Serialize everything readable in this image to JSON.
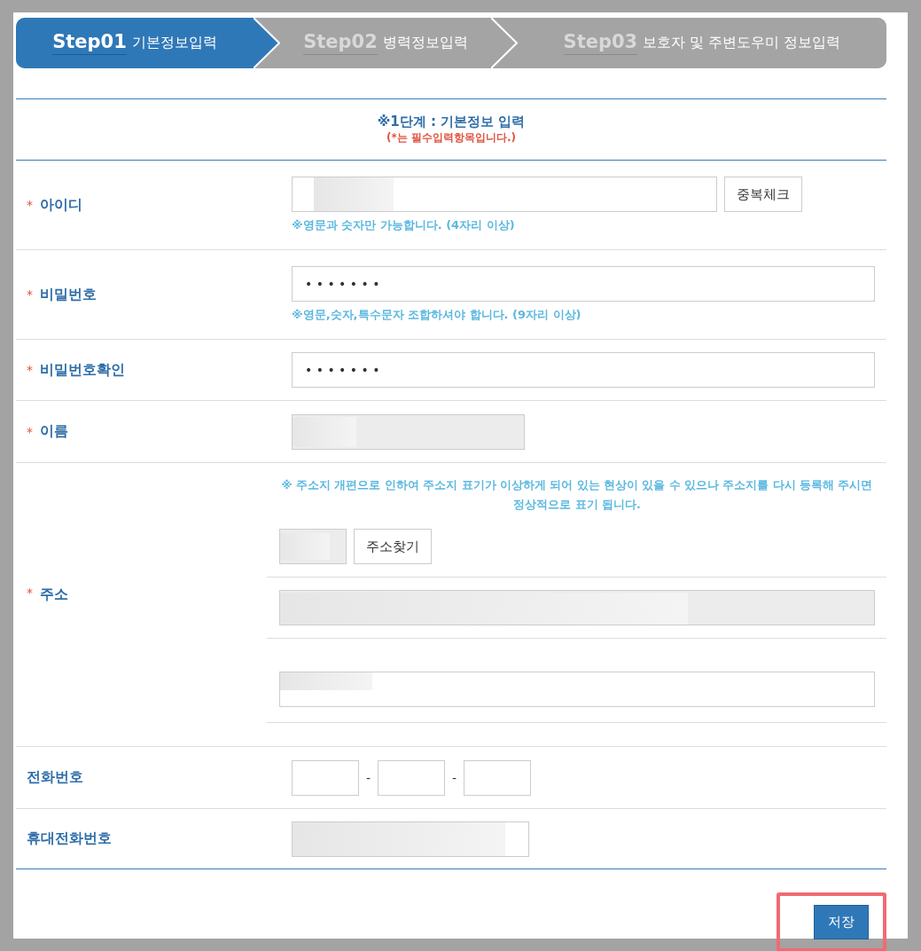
{
  "steps": [
    {
      "number": "Step01",
      "label": "기본정보입력",
      "selected": true
    },
    {
      "number": "Step02",
      "label": "병력정보입력",
      "selected": false
    },
    {
      "number": "Step03",
      "label": "보호자 및 주변도우미 정보입력",
      "selected": false
    }
  ],
  "heading": {
    "title": "※1단계 : 기본정보 입력",
    "subtitle": "(*는 필수입력항목입니다.)"
  },
  "rows": [
    {
      "kind": "id",
      "label": "아이디",
      "required_mark": "*",
      "button": "중복체크",
      "hint": "※영문과 숫자만 가능합니다. (4자리 이상)"
    },
    {
      "kind": "password",
      "label": "비밀번호",
      "required_mark": "*",
      "value": "• • • • • • •",
      "hint": "※영문,숫자,특수문자 조합하셔야 합니다. (9자리 이상)"
    },
    {
      "kind": "password",
      "label": "비밀번호확인",
      "required_mark": "*",
      "value": "• • • • • • •"
    },
    {
      "kind": "name",
      "label": "이름",
      "required_mark": "*"
    },
    {
      "kind": "address",
      "label": "주소",
      "required_mark": "*",
      "note": "※ 주소지 개편으로 인하여 주소지 표기가 이상하게 되어 있는 현상이 있을 수 있으나 주소지를 다시 등록해 주시면 정상적으로 표기 됩니다.",
      "button": "주소찾기"
    },
    {
      "kind": "phone",
      "label": "전화번호",
      "separators": [
        "-",
        "-"
      ]
    },
    {
      "kind": "mobile",
      "label": "휴대전화번호"
    }
  ],
  "save_button": "저장"
}
